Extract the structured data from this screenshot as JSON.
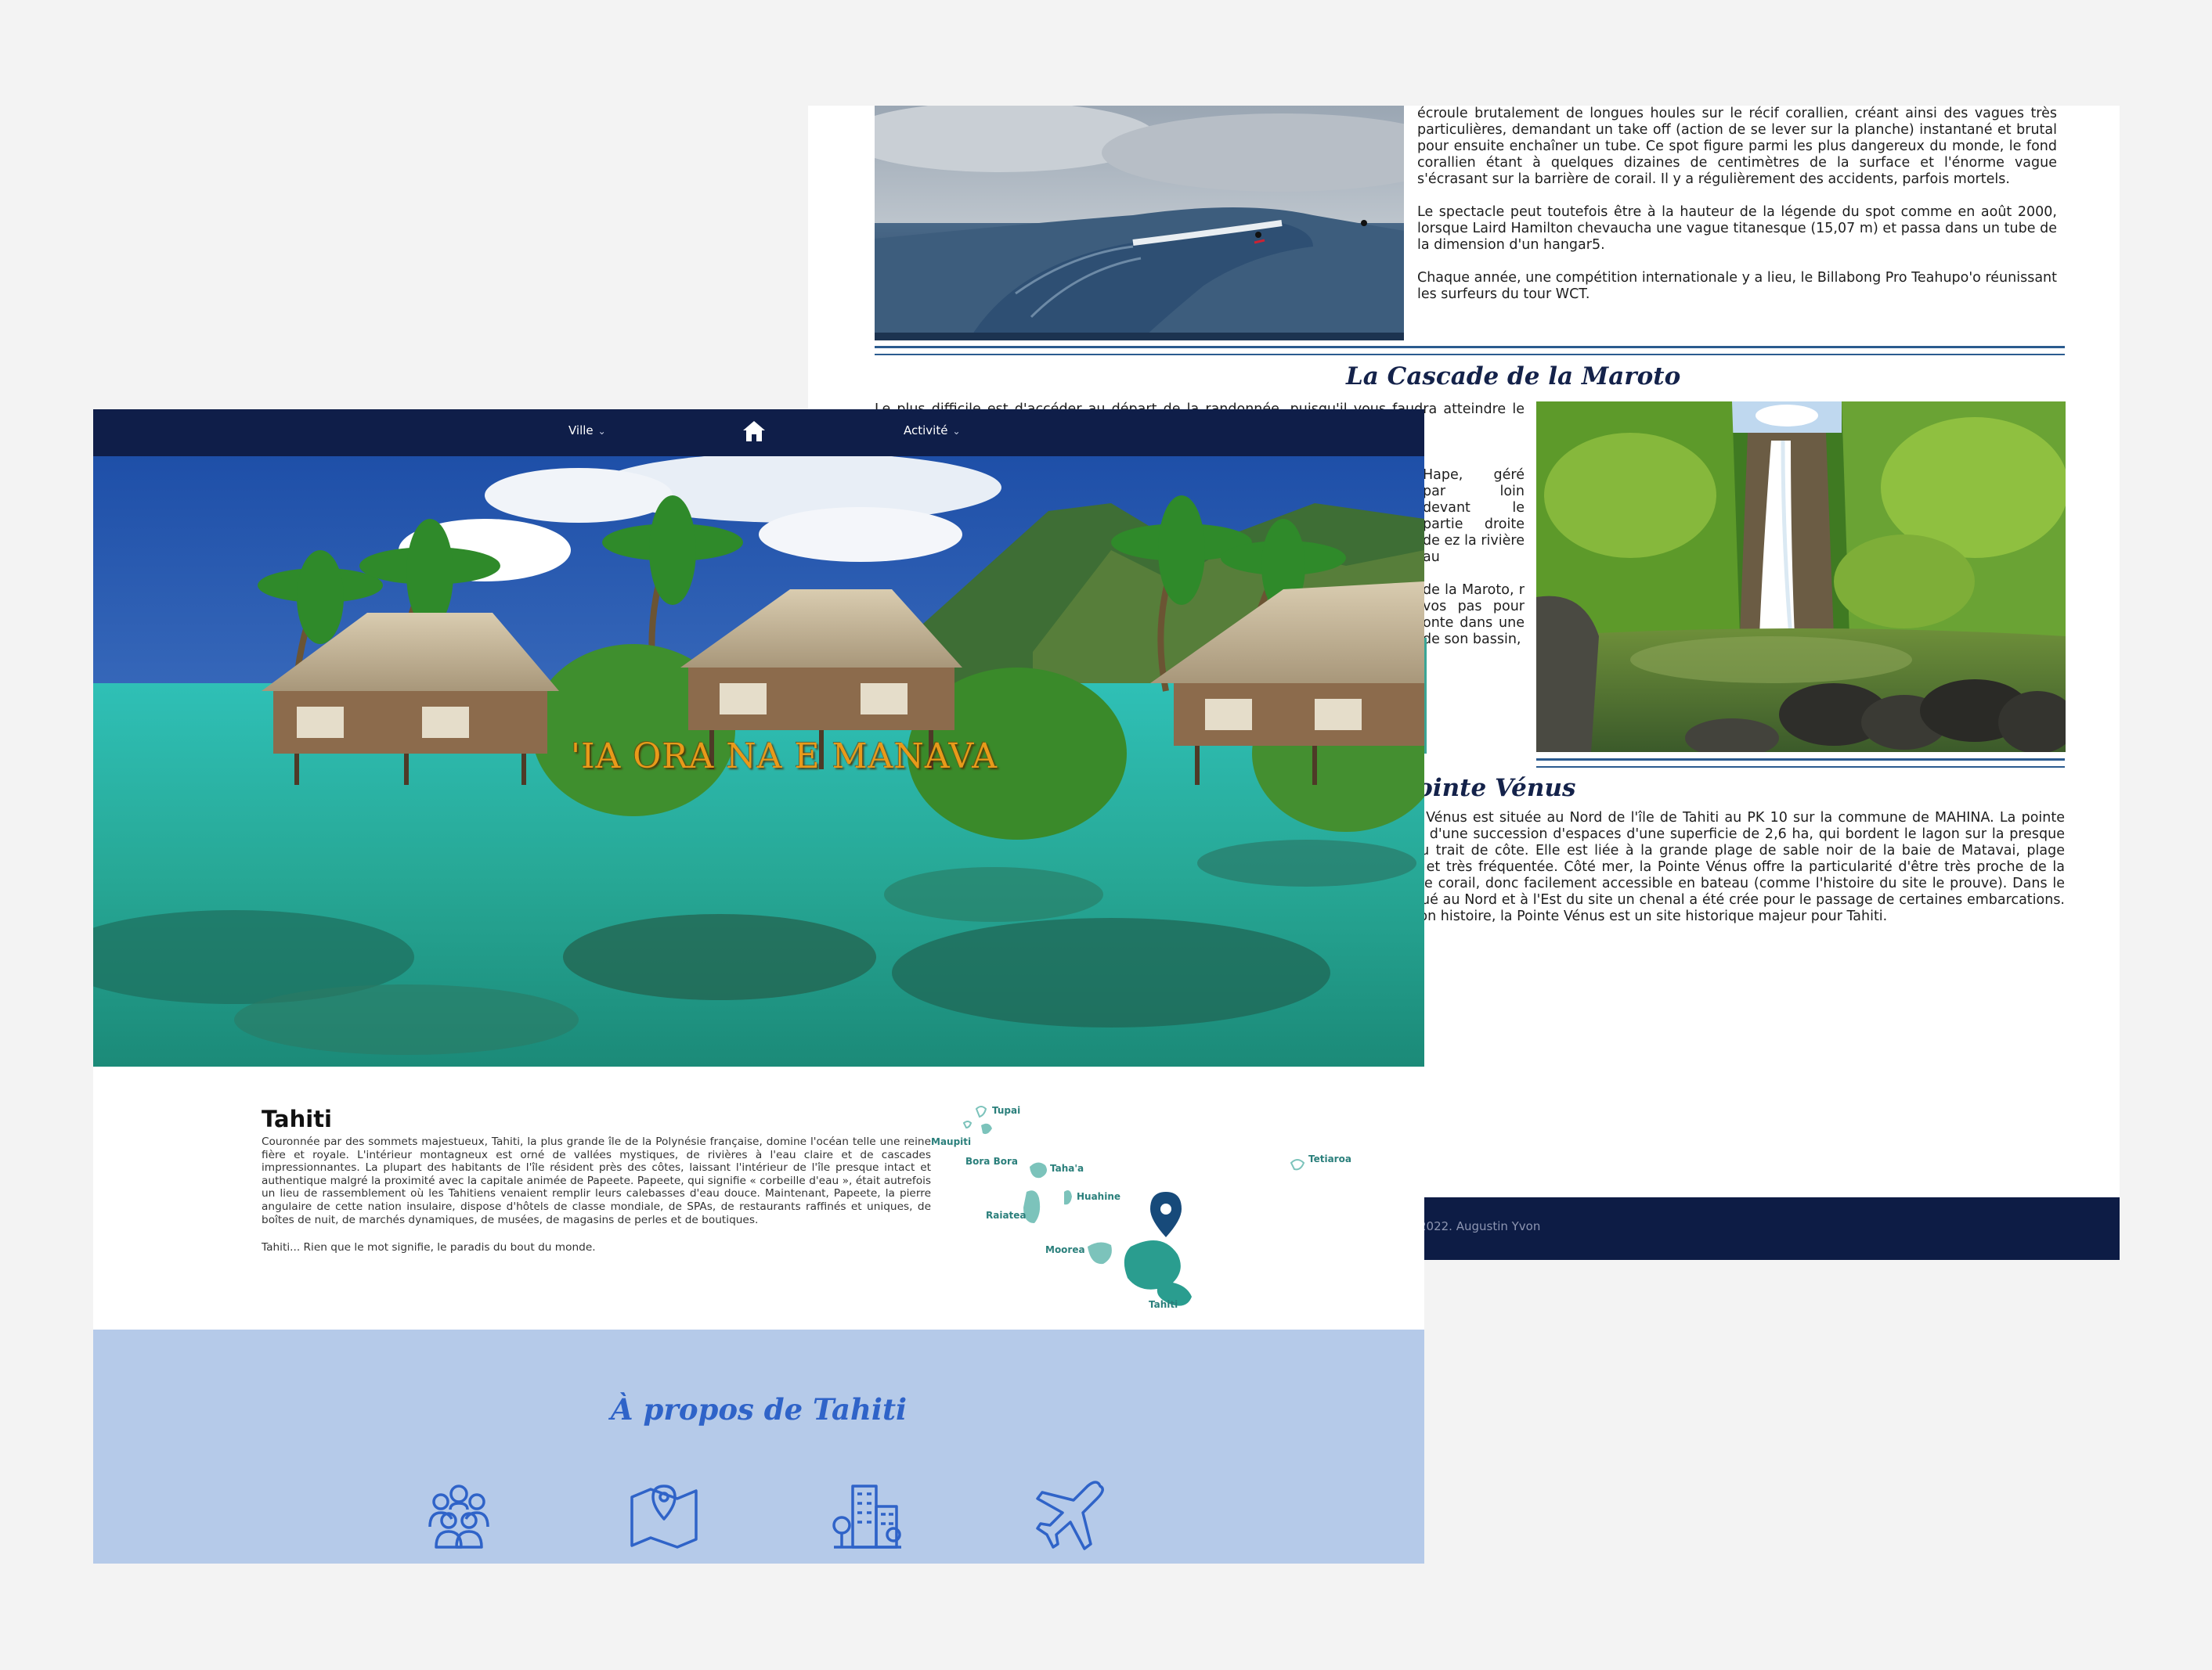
{
  "back_page": {
    "surf_paragraphs": [
      "écroule brutalement de longues houles sur le récif corallien, créant ainsi des vagues très particulières, demandant un take off (action de se lever sur la planche) instantané et brutal pour ensuite enchaîner un tube. Ce spot figure parmi les plus dangereux du monde, le fond corallien étant à quelques dizaines de centimètres de la surface et l'énorme vague s'écrasant sur la barrière de corail. Il y a régulièrement des accidents, parfois mortels.",
      "Le spectacle peut toutefois être à la hauteur de la légende du spot comme en août 2000, lorsque Laird Hamilton chevaucha une vague titanesque (15,07 m) et passa dans un tube de la dimension d'un hangar5.",
      "Chaque année, une compétition internationale y a lieu, le Billabong Pro Teahupo'o réunissant les surfeurs du tour WCT."
    ],
    "cascade_title": "La Cascade de la Maroto",
    "cascade_paragraphs": [
      "Le plus difficile est d'accéder au départ de la randonnée, puisqu'il vous faudra atteindre le relais de la Maroto, un 4x4 est recommandé pour les gués des rivières. Si",
      "Hape, géré par loin devant le partie droite de ez la rivière au",
      "de la Maroto, r vos pas pour onte dans une de son bassin,"
    ],
    "venus_title": "La Pointe Vénus",
    "venus_paragraph": "La Pointe Vénus est située au Nord de l'île de Tahiti au PK 10 sur la commune de MAHINA. La pointe fait partie d'une succession d'espaces d'une superficie de 2,6 ha, qui bordent le lagon sur la presque totalité du trait de côte. Elle est liée à la grande plage de sable noir de la baie de Matavai, plage populaire et très fréquentée. Côté mer, la Pointe Vénus offre la particularité d'être très proche de la barrière de corail, donc facilement accessible en bateau (comme l'histoire du site le prouve). Dans le platier situé au Nord et à l'Est du site un chenal a été crée pour le passage de certaines embarcations. De part son histoire, la Pointe Vénus est un site historique majeur pour Tahiti.",
    "footer_text": "2022. Augustin Yvon"
  },
  "front_page": {
    "nav": {
      "ville_label": "Ville",
      "activite_label": "Activité"
    },
    "hero_title": "'IA ORA NA E MANAVA",
    "tahiti": {
      "title": "Tahiti",
      "body": "Couronnée par des sommets majestueux, Tahiti, la plus grande île de la Polynésie française, domine l'océan telle une reine fière et royale. L'intérieur montagneux est orné de vallées mystiques, de rivières à l'eau claire et de cascades impressionnantes. La plupart des habitants de l'île résident près des côtes, laissant l'intérieur de l'île presque intact et authentique malgré la proximité avec la capitale animée de Papeete. Papeete, qui signifie « corbeille d'eau », était autrefois un lieu de rassemblement où les Tahitiens venaient remplir leurs calebasses d'eau douce. Maintenant, Papeete, la pierre angulaire de cette nation insulaire, dispose d'hôtels de classe mondiale, de SPAs, de restaurants raffinés et uniques, de boîtes de nuit, de marchés dynamiques, de musées, de magasins de perles et de boutiques.",
      "tagline": "Tahiti... Rien que le mot signifie, le paradis du bout du monde."
    },
    "map_labels": {
      "tupai": "Tupai",
      "maupiti": "Maupiti",
      "bora_bora": "Bora Bora",
      "tahaa": "Taha'a",
      "tetiaroa": "Tetiaroa",
      "huahine": "Huahine",
      "raiatea": "Raiatea",
      "moorea": "Moorea",
      "tahiti": "Tahiti"
    },
    "about_title": "À propos de Tahiti",
    "about_icons": [
      "people-group-icon",
      "map-pin-icon",
      "city-buildings-icon",
      "airplane-icon"
    ]
  },
  "colors": {
    "navy": "#0f1e49",
    "hero_title": "#e89a1a",
    "about_bg": "#b5cae9",
    "about_accent": "#2f63c8",
    "map_teal": "#2a9d8f",
    "section_title": "#14224a"
  }
}
